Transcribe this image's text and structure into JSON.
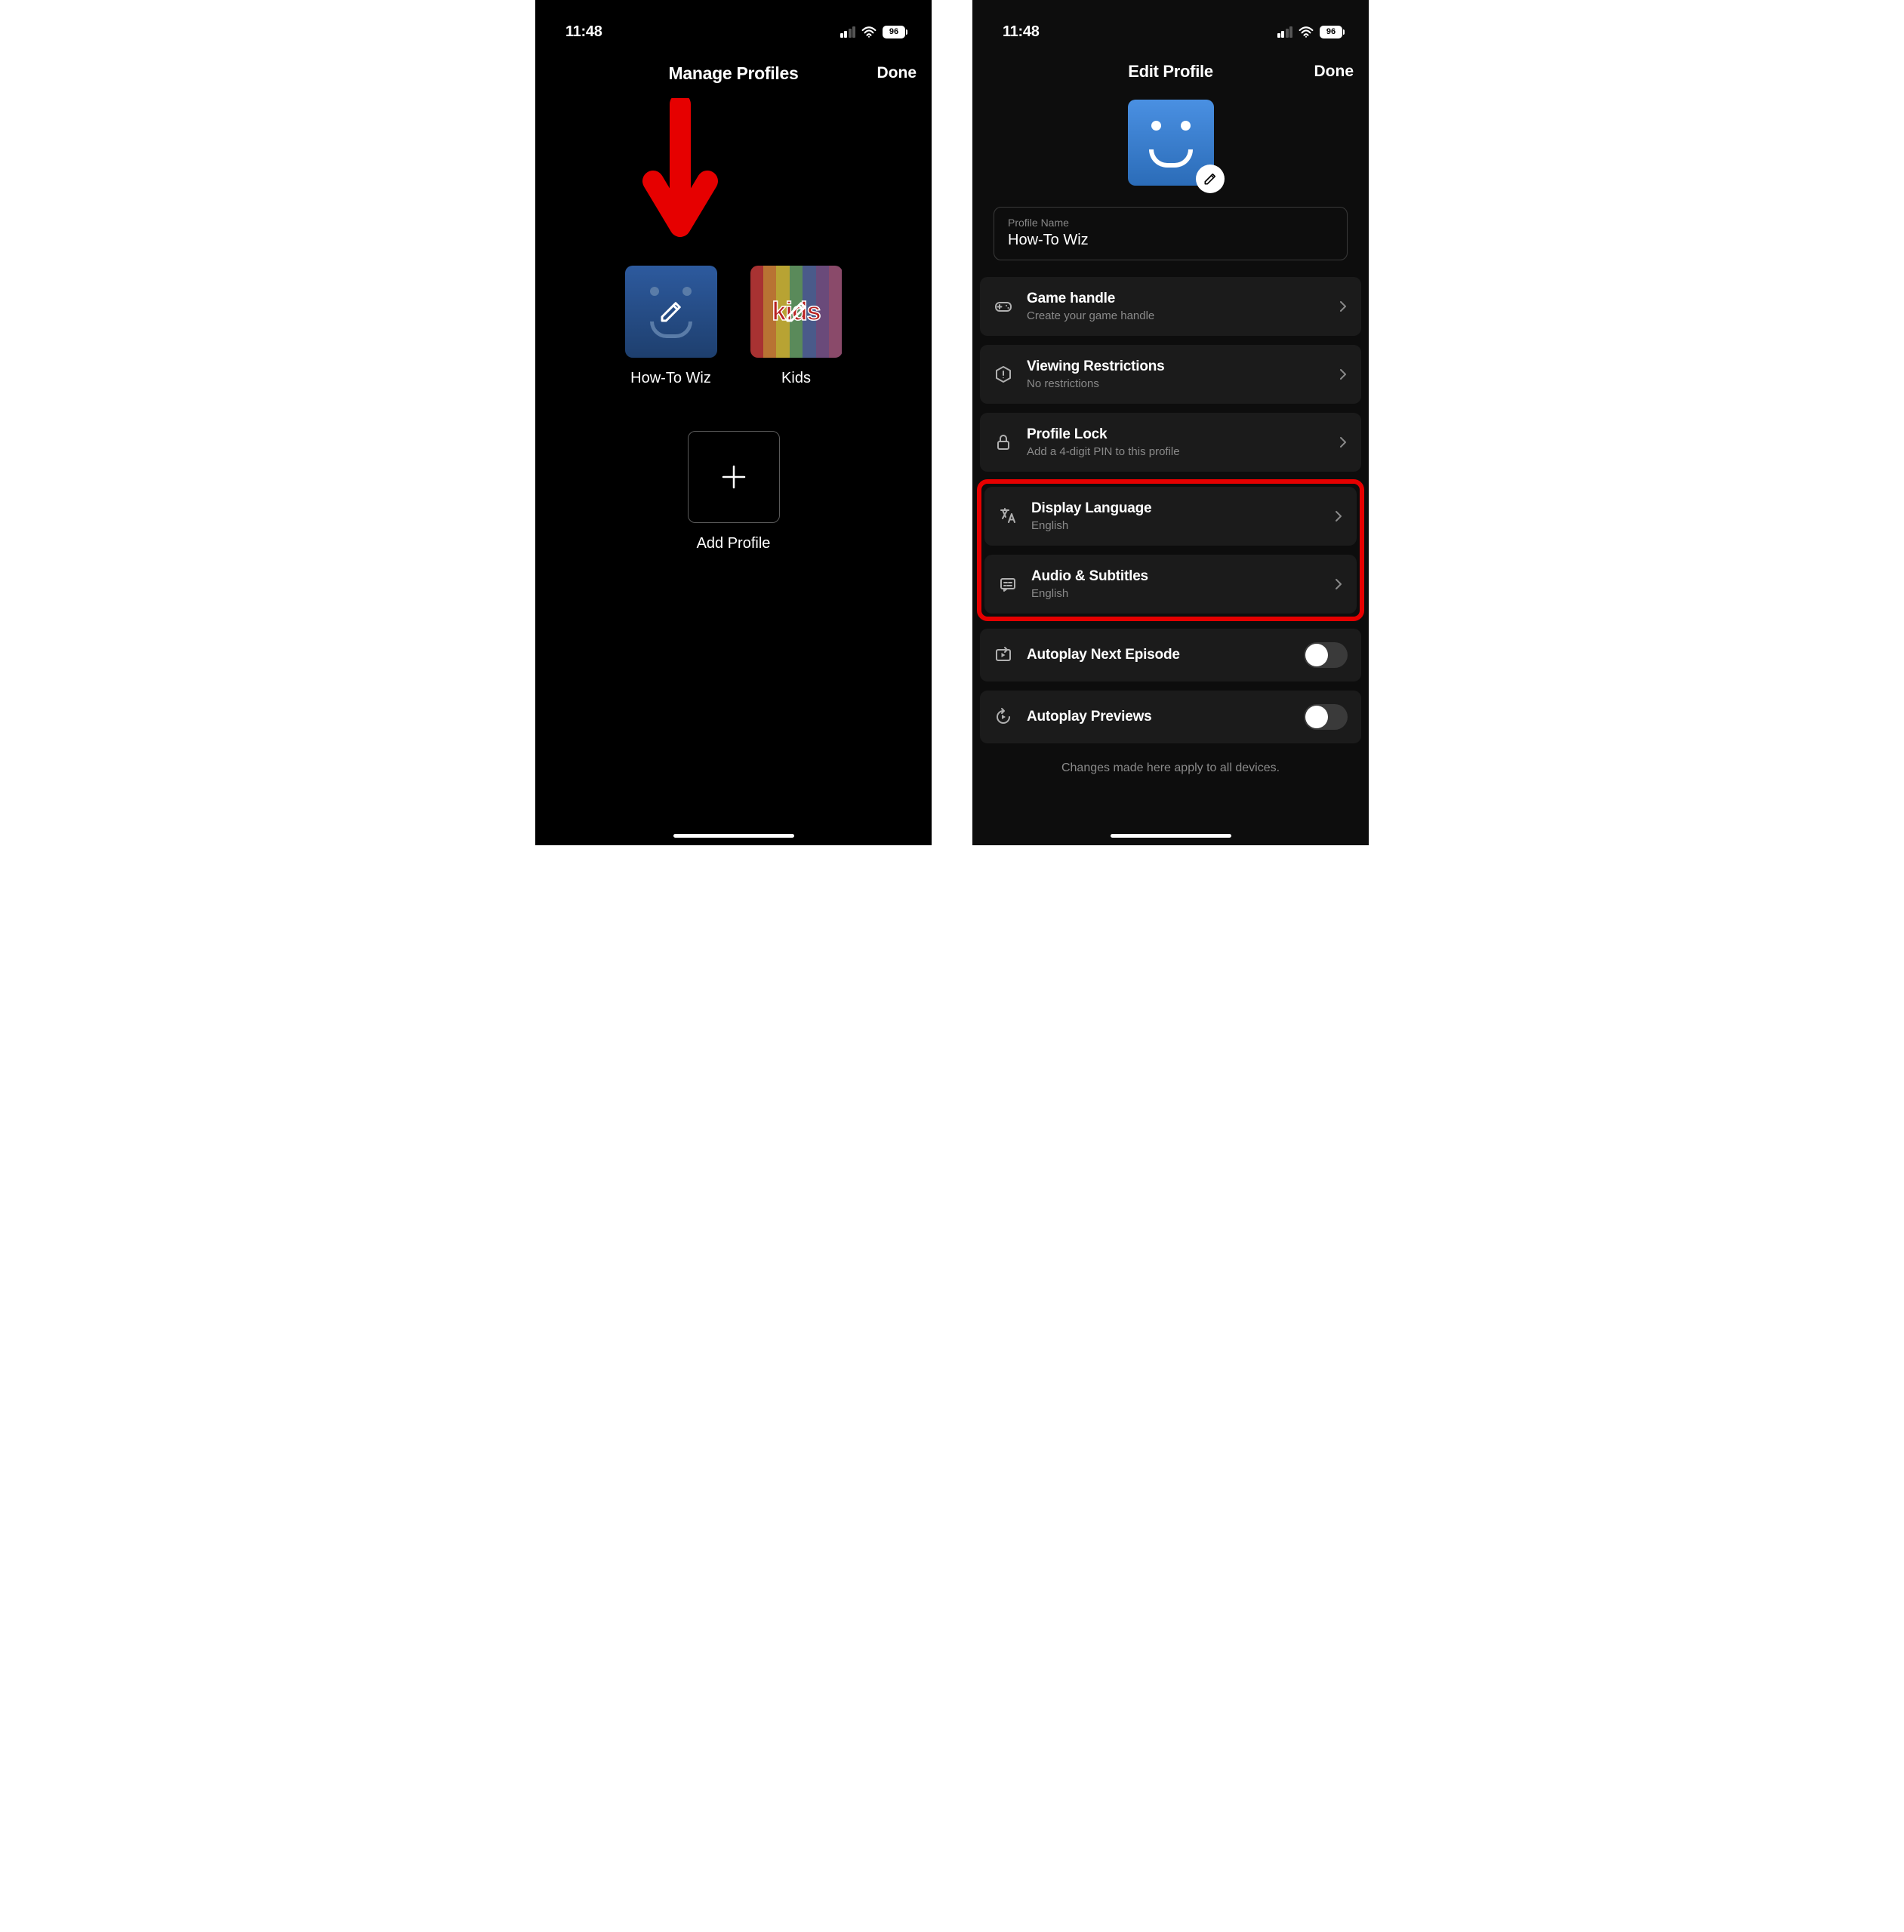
{
  "status": {
    "time": "11:48",
    "battery": "96"
  },
  "left": {
    "title": "Manage Profiles",
    "done": "Done",
    "profiles": [
      {
        "name": "How-To Wiz"
      },
      {
        "name": "Kids"
      }
    ],
    "add_label": "Add Profile"
  },
  "right": {
    "title": "Edit Profile",
    "done": "Done",
    "name_field_label": "Profile Name",
    "name_value": "How-To Wiz",
    "settings": {
      "game_handle": {
        "title": "Game handle",
        "sub": "Create your game handle"
      },
      "viewing": {
        "title": "Viewing Restrictions",
        "sub": "No restrictions"
      },
      "lock": {
        "title": "Profile Lock",
        "sub": "Add a 4-digit PIN to this profile"
      },
      "language": {
        "title": "Display Language",
        "sub": "English"
      },
      "audio": {
        "title": "Audio & Subtitles",
        "sub": "English"
      },
      "autoplay_next": {
        "title": "Autoplay Next Episode"
      },
      "autoplay_prev": {
        "title": "Autoplay Previews"
      }
    },
    "footnote": "Changes made here apply to all devices."
  },
  "kids_text": "kids"
}
